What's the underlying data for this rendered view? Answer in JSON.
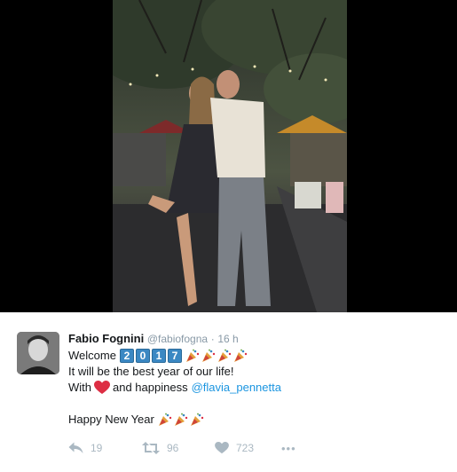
{
  "tweet": {
    "author_name": "Fabio Fognini",
    "author_handle": "@fabiofogna",
    "separator": "·",
    "timestamp": "16 h",
    "line1_prefix": "Welcome",
    "year_digits": [
      "2",
      "0",
      "1",
      "7"
    ],
    "line2": "It will be the best year of our life!",
    "line3_prefix": "With",
    "line3_middle": "and happiness",
    "mention": "@flavia_pennetta",
    "line4": "Happy New Year"
  },
  "actions": {
    "reply_count": "19",
    "retweet_count": "96",
    "like_count": "723",
    "more_label": "•••"
  },
  "icons": {
    "reply": "reply-icon",
    "retweet": "retweet-icon",
    "like": "heart-outline-icon",
    "more": "more-dots-icon",
    "party": "party-popper-emoji",
    "heart": "red-heart-emoji"
  },
  "colors": {
    "link": "#1b95e0",
    "muted": "#8899a6",
    "action": "#aab8c2",
    "keycap": "#3b88c3",
    "heart": "#dd2e44"
  }
}
